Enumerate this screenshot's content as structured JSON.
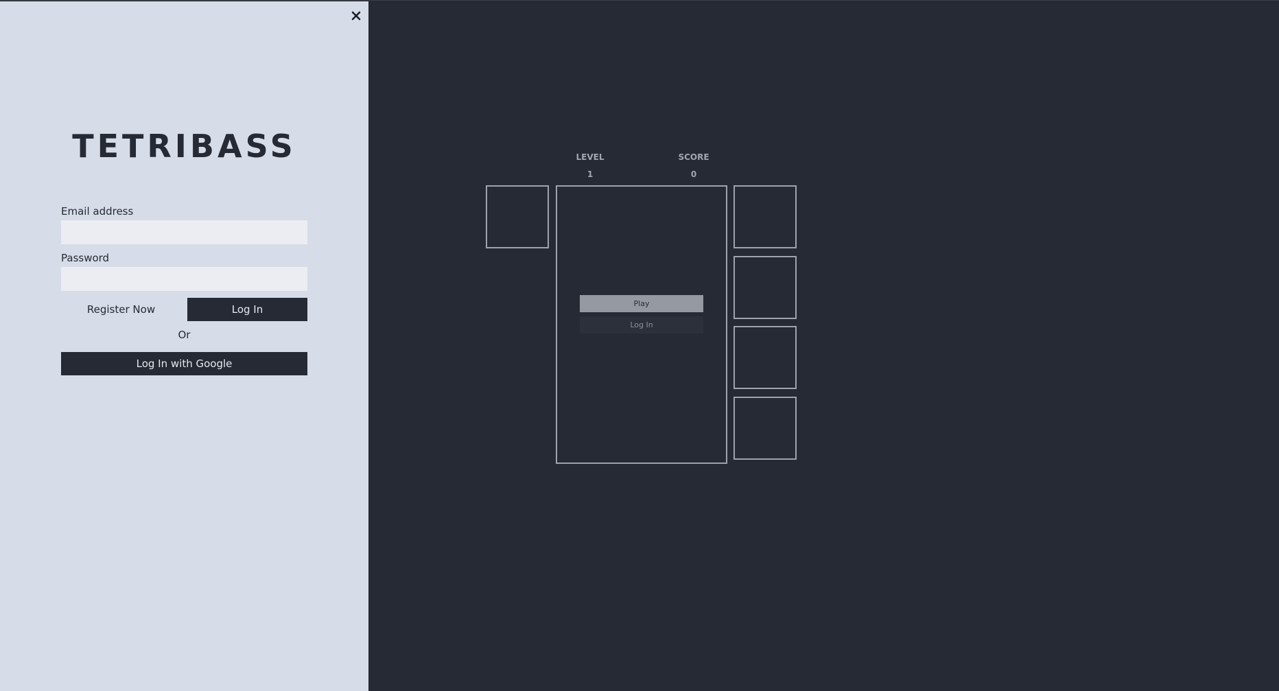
{
  "login_panel": {
    "brand": "TETRIBASS",
    "email_label": "Email address",
    "email_value": "",
    "password_label": "Password",
    "password_value": "",
    "register_label": "Register Now",
    "login_label": "Log In",
    "or_label": "Or",
    "google_label": "Log In with Google",
    "close_icon": "close-icon"
  },
  "game": {
    "level_label": "LEVEL",
    "level_value": "1",
    "score_label": "SCORE",
    "score_value": "0",
    "play_label": "Play",
    "login_label": "Log In"
  },
  "colors": {
    "panel_bg": "#d6dce8",
    "app_bg": "#262a34",
    "border": "#9ea3ad",
    "accent_dark": "#262a34"
  }
}
